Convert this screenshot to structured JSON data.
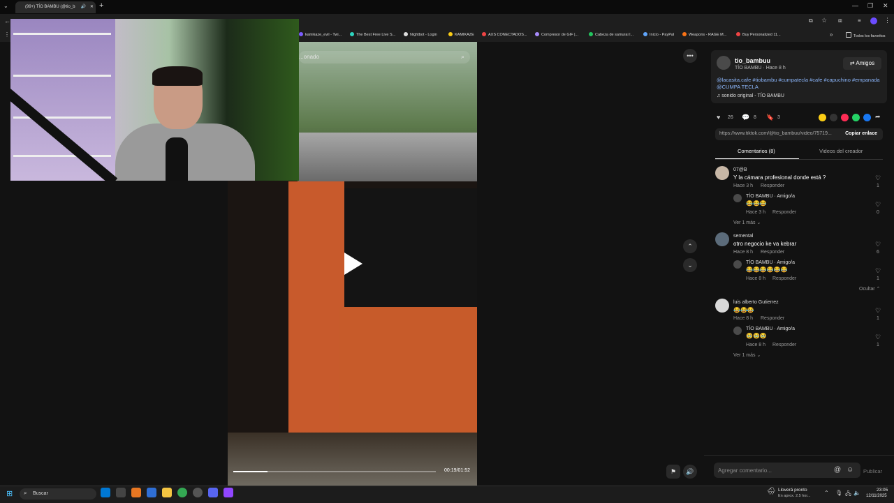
{
  "browser": {
    "tab_title": "(99+) TÍO BAMBU (@tio_ba",
    "bookmarks": [
      "kamikaze_evil - Twi...",
      "The Best Free Live S...",
      "Nightbot - Login",
      "KAMIKAZE",
      "AXS CONECTADOS...",
      "Compresor de GIF |...",
      "Cabeza de samurai l...",
      "Inicio - PayPal",
      "Weapons - RAGE M...",
      "Buy Personalized 11..."
    ],
    "all_bookmarks": "Todos los favoritos"
  },
  "video": {
    "search_placeholder": "...onado",
    "time": "00:19/01:52",
    "progress": 0.17
  },
  "post": {
    "username": "tio_bambuu",
    "author_line": "TÍO BAMBU · Hace 8 h",
    "friends_button": "Amigos",
    "caption": "@lacasita.cafe #tiobambu #cumpatecla #cafe #capuchino #empanada @CUMPA TECLA",
    "sound": "sonido original - TÍO BAMBU",
    "likes": "26",
    "comments": "8",
    "saves": "3",
    "url": "https://www.tiktok.com/@tio_bambuu/video/75719...",
    "copy_link": "Copiar enlace",
    "tab_comments": "Comentarios (8)",
    "tab_videos": "Videos del creador"
  },
  "comments": [
    {
      "user": "07@B",
      "text": "Y la cámara profesional donde está ?",
      "time": "Hace 3 h",
      "reply": "Responder",
      "likes": "1",
      "sub": {
        "user": "TÍO BAMBU · Amigo/a",
        "text": "😂😂😂",
        "time": "Hace 3 h",
        "reply": "Responder",
        "likes": "0"
      },
      "more": "Ver 1 más"
    },
    {
      "user": "semental",
      "text": "otro negocio ke va kebrar",
      "time": "Hace 8 h",
      "reply": "Responder",
      "likes": "6",
      "sub": {
        "user": "TÍO BAMBU · Amigo/a",
        "text": "😂😂😂😂😂😂",
        "time": "Hace 8 h",
        "reply": "Responder",
        "likes": "1"
      },
      "more": "Ocultar"
    },
    {
      "user": "luis alberto Gutierrez",
      "text": "😂😂😂",
      "time": "Hace 8 h",
      "reply": "Responder",
      "likes": "1",
      "sub": {
        "user": "TÍO BAMBU · Amigo/a",
        "text": "🥹🥹🥹",
        "time": "Hace 8 h",
        "reply": "Responder",
        "likes": "1"
      },
      "more": "Ver 1 más"
    }
  ],
  "composer": {
    "placeholder": "Agregar comentario...",
    "publish": "Publicar"
  },
  "taskbar": {
    "search": "Buscar",
    "weather": "Lloverá pronto",
    "weather_sub": "En aprox. 2.5 hor...",
    "clock": "23:05",
    "date": "12/11/2025"
  },
  "colors": {
    "accent": "#fe2c55",
    "link": "#8ab4f8",
    "taskbar": "#1c1c1c"
  }
}
